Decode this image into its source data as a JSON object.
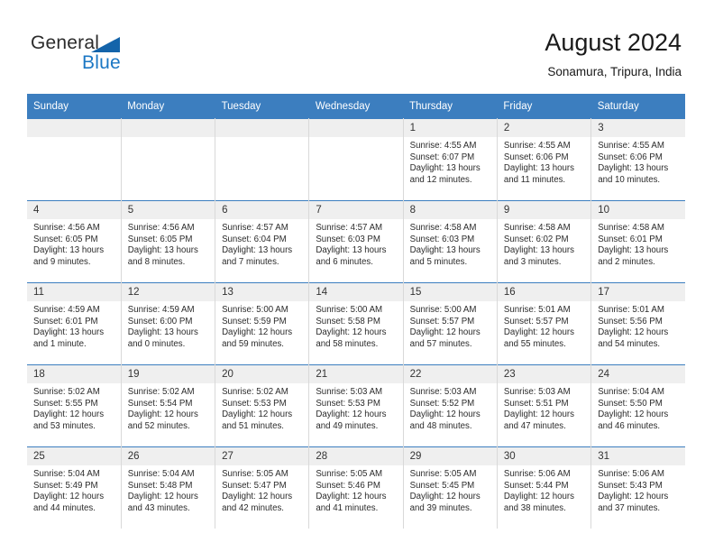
{
  "brand": {
    "name_part1": "General",
    "name_part2": "Blue",
    "accent_color": "#1b77c4",
    "triangle_color": "#1464aa"
  },
  "header": {
    "title": "August 2024",
    "subtitle": "Sonamura, Tripura, India"
  },
  "calendar": {
    "header_bg": "#3c7ebf",
    "daynum_bg": "#efefef",
    "weekdays": [
      "Sunday",
      "Monday",
      "Tuesday",
      "Wednesday",
      "Thursday",
      "Friday",
      "Saturday"
    ],
    "weeks": [
      [
        {
          "day": "",
          "empty": true,
          "sunrise": "",
          "sunset": "",
          "daylight1": "",
          "daylight2": ""
        },
        {
          "day": "",
          "empty": true,
          "sunrise": "",
          "sunset": "",
          "daylight1": "",
          "daylight2": ""
        },
        {
          "day": "",
          "empty": true,
          "sunrise": "",
          "sunset": "",
          "daylight1": "",
          "daylight2": ""
        },
        {
          "day": "",
          "empty": true,
          "sunrise": "",
          "sunset": "",
          "daylight1": "",
          "daylight2": ""
        },
        {
          "day": "1",
          "empty": false,
          "sunrise": "Sunrise: 4:55 AM",
          "sunset": "Sunset: 6:07 PM",
          "daylight1": "Daylight: 13 hours",
          "daylight2": "and 12 minutes."
        },
        {
          "day": "2",
          "empty": false,
          "sunrise": "Sunrise: 4:55 AM",
          "sunset": "Sunset: 6:06 PM",
          "daylight1": "Daylight: 13 hours",
          "daylight2": "and 11 minutes."
        },
        {
          "day": "3",
          "empty": false,
          "sunrise": "Sunrise: 4:55 AM",
          "sunset": "Sunset: 6:06 PM",
          "daylight1": "Daylight: 13 hours",
          "daylight2": "and 10 minutes."
        }
      ],
      [
        {
          "day": "4",
          "empty": false,
          "sunrise": "Sunrise: 4:56 AM",
          "sunset": "Sunset: 6:05 PM",
          "daylight1": "Daylight: 13 hours",
          "daylight2": "and 9 minutes."
        },
        {
          "day": "5",
          "empty": false,
          "sunrise": "Sunrise: 4:56 AM",
          "sunset": "Sunset: 6:05 PM",
          "daylight1": "Daylight: 13 hours",
          "daylight2": "and 8 minutes."
        },
        {
          "day": "6",
          "empty": false,
          "sunrise": "Sunrise: 4:57 AM",
          "sunset": "Sunset: 6:04 PM",
          "daylight1": "Daylight: 13 hours",
          "daylight2": "and 7 minutes."
        },
        {
          "day": "7",
          "empty": false,
          "sunrise": "Sunrise: 4:57 AM",
          "sunset": "Sunset: 6:03 PM",
          "daylight1": "Daylight: 13 hours",
          "daylight2": "and 6 minutes."
        },
        {
          "day": "8",
          "empty": false,
          "sunrise": "Sunrise: 4:58 AM",
          "sunset": "Sunset: 6:03 PM",
          "daylight1": "Daylight: 13 hours",
          "daylight2": "and 5 minutes."
        },
        {
          "day": "9",
          "empty": false,
          "sunrise": "Sunrise: 4:58 AM",
          "sunset": "Sunset: 6:02 PM",
          "daylight1": "Daylight: 13 hours",
          "daylight2": "and 3 minutes."
        },
        {
          "day": "10",
          "empty": false,
          "sunrise": "Sunrise: 4:58 AM",
          "sunset": "Sunset: 6:01 PM",
          "daylight1": "Daylight: 13 hours",
          "daylight2": "and 2 minutes."
        }
      ],
      [
        {
          "day": "11",
          "empty": false,
          "sunrise": "Sunrise: 4:59 AM",
          "sunset": "Sunset: 6:01 PM",
          "daylight1": "Daylight: 13 hours",
          "daylight2": "and 1 minute."
        },
        {
          "day": "12",
          "empty": false,
          "sunrise": "Sunrise: 4:59 AM",
          "sunset": "Sunset: 6:00 PM",
          "daylight1": "Daylight: 13 hours",
          "daylight2": "and 0 minutes."
        },
        {
          "day": "13",
          "empty": false,
          "sunrise": "Sunrise: 5:00 AM",
          "sunset": "Sunset: 5:59 PM",
          "daylight1": "Daylight: 12 hours",
          "daylight2": "and 59 minutes."
        },
        {
          "day": "14",
          "empty": false,
          "sunrise": "Sunrise: 5:00 AM",
          "sunset": "Sunset: 5:58 PM",
          "daylight1": "Daylight: 12 hours",
          "daylight2": "and 58 minutes."
        },
        {
          "day": "15",
          "empty": false,
          "sunrise": "Sunrise: 5:00 AM",
          "sunset": "Sunset: 5:57 PM",
          "daylight1": "Daylight: 12 hours",
          "daylight2": "and 57 minutes."
        },
        {
          "day": "16",
          "empty": false,
          "sunrise": "Sunrise: 5:01 AM",
          "sunset": "Sunset: 5:57 PM",
          "daylight1": "Daylight: 12 hours",
          "daylight2": "and 55 minutes."
        },
        {
          "day": "17",
          "empty": false,
          "sunrise": "Sunrise: 5:01 AM",
          "sunset": "Sunset: 5:56 PM",
          "daylight1": "Daylight: 12 hours",
          "daylight2": "and 54 minutes."
        }
      ],
      [
        {
          "day": "18",
          "empty": false,
          "sunrise": "Sunrise: 5:02 AM",
          "sunset": "Sunset: 5:55 PM",
          "daylight1": "Daylight: 12 hours",
          "daylight2": "and 53 minutes."
        },
        {
          "day": "19",
          "empty": false,
          "sunrise": "Sunrise: 5:02 AM",
          "sunset": "Sunset: 5:54 PM",
          "daylight1": "Daylight: 12 hours",
          "daylight2": "and 52 minutes."
        },
        {
          "day": "20",
          "empty": false,
          "sunrise": "Sunrise: 5:02 AM",
          "sunset": "Sunset: 5:53 PM",
          "daylight1": "Daylight: 12 hours",
          "daylight2": "and 51 minutes."
        },
        {
          "day": "21",
          "empty": false,
          "sunrise": "Sunrise: 5:03 AM",
          "sunset": "Sunset: 5:53 PM",
          "daylight1": "Daylight: 12 hours",
          "daylight2": "and 49 minutes."
        },
        {
          "day": "22",
          "empty": false,
          "sunrise": "Sunrise: 5:03 AM",
          "sunset": "Sunset: 5:52 PM",
          "daylight1": "Daylight: 12 hours",
          "daylight2": "and 48 minutes."
        },
        {
          "day": "23",
          "empty": false,
          "sunrise": "Sunrise: 5:03 AM",
          "sunset": "Sunset: 5:51 PM",
          "daylight1": "Daylight: 12 hours",
          "daylight2": "and 47 minutes."
        },
        {
          "day": "24",
          "empty": false,
          "sunrise": "Sunrise: 5:04 AM",
          "sunset": "Sunset: 5:50 PM",
          "daylight1": "Daylight: 12 hours",
          "daylight2": "and 46 minutes."
        }
      ],
      [
        {
          "day": "25",
          "empty": false,
          "sunrise": "Sunrise: 5:04 AM",
          "sunset": "Sunset: 5:49 PM",
          "daylight1": "Daylight: 12 hours",
          "daylight2": "and 44 minutes."
        },
        {
          "day": "26",
          "empty": false,
          "sunrise": "Sunrise: 5:04 AM",
          "sunset": "Sunset: 5:48 PM",
          "daylight1": "Daylight: 12 hours",
          "daylight2": "and 43 minutes."
        },
        {
          "day": "27",
          "empty": false,
          "sunrise": "Sunrise: 5:05 AM",
          "sunset": "Sunset: 5:47 PM",
          "daylight1": "Daylight: 12 hours",
          "daylight2": "and 42 minutes."
        },
        {
          "day": "28",
          "empty": false,
          "sunrise": "Sunrise: 5:05 AM",
          "sunset": "Sunset: 5:46 PM",
          "daylight1": "Daylight: 12 hours",
          "daylight2": "and 41 minutes."
        },
        {
          "day": "29",
          "empty": false,
          "sunrise": "Sunrise: 5:05 AM",
          "sunset": "Sunset: 5:45 PM",
          "daylight1": "Daylight: 12 hours",
          "daylight2": "and 39 minutes."
        },
        {
          "day": "30",
          "empty": false,
          "sunrise": "Sunrise: 5:06 AM",
          "sunset": "Sunset: 5:44 PM",
          "daylight1": "Daylight: 12 hours",
          "daylight2": "and 38 minutes."
        },
        {
          "day": "31",
          "empty": false,
          "sunrise": "Sunrise: 5:06 AM",
          "sunset": "Sunset: 5:43 PM",
          "daylight1": "Daylight: 12 hours",
          "daylight2": "and 37 minutes."
        }
      ]
    ]
  }
}
